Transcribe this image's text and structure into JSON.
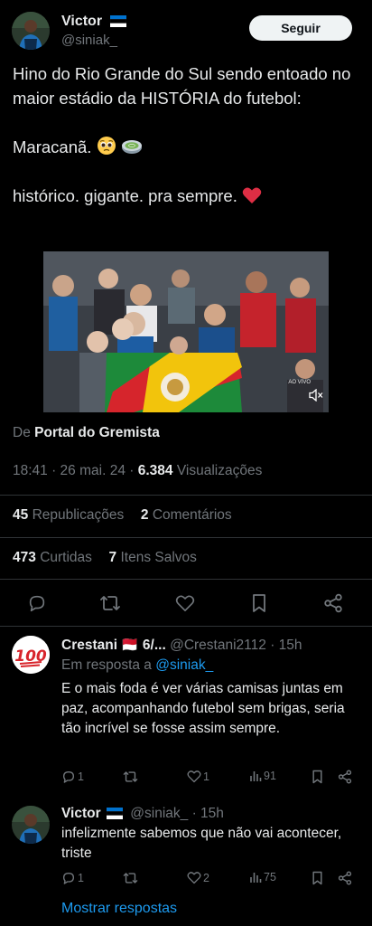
{
  "tweet": {
    "author_name": "Victor",
    "author_flag": "🇪🇪",
    "author_handle": "@siniak_",
    "follow_label": "Seguir",
    "text_line1": "Hino do Rio Grande do Sul sendo entoado no maior estádio da HISTÓRIA do futebol:",
    "text_line2": "Maracanã.",
    "text_line2_emojis": [
      "pleading-face",
      "stadium"
    ],
    "text_line3": "histórico. gigante. pra sempre.",
    "text_line3_emoji": "❤️",
    "media_live_label": "AO VIVO",
    "source_prefix": "De",
    "source_name": "Portal do Gremista",
    "timestamp": "18:41 · 26 mai. 24 ·",
    "views_count": "6.384",
    "views_label": "Visualizações",
    "reposts_count": "45",
    "reposts_label": "Republicações",
    "comments_count": "2",
    "comments_label": "Comentários",
    "likes_count": "473",
    "likes_label": "Curtidas",
    "saves_count": "7",
    "saves_label": "Itens Salvos",
    "actions": [
      "reply-icon",
      "repost-icon",
      "like-icon",
      "bookmark-icon",
      "share-icon"
    ]
  },
  "replies": [
    {
      "name": "Crestani 🇲🇨 6/...",
      "handle": "@Crestani2112",
      "time": "· 15h",
      "replying_prefix": "Em resposta a",
      "replying_to": "@siniak_",
      "text": "E o mais foda é ver várias camisas juntas em paz, acompanhando futebol sem brigas, seria tão incrível se fosse assim sempre.",
      "reply_count": "1",
      "repost_count": "",
      "like_count": "1",
      "view_count": "91"
    },
    {
      "name": "Victor",
      "handle": "@siniak_",
      "time": "· 15h",
      "text": "infelizmente sabemos que não vai acontecer, triste",
      "reply_count": "1",
      "repost_count": "",
      "like_count": "2",
      "view_count": "75"
    }
  ],
  "show_replies_label": "Mostrar respostas",
  "colors": {
    "background": "#000000",
    "text": "#e7e9ea",
    "muted": "#71767b",
    "link": "#1d9bf0",
    "divider": "#2f3336"
  }
}
